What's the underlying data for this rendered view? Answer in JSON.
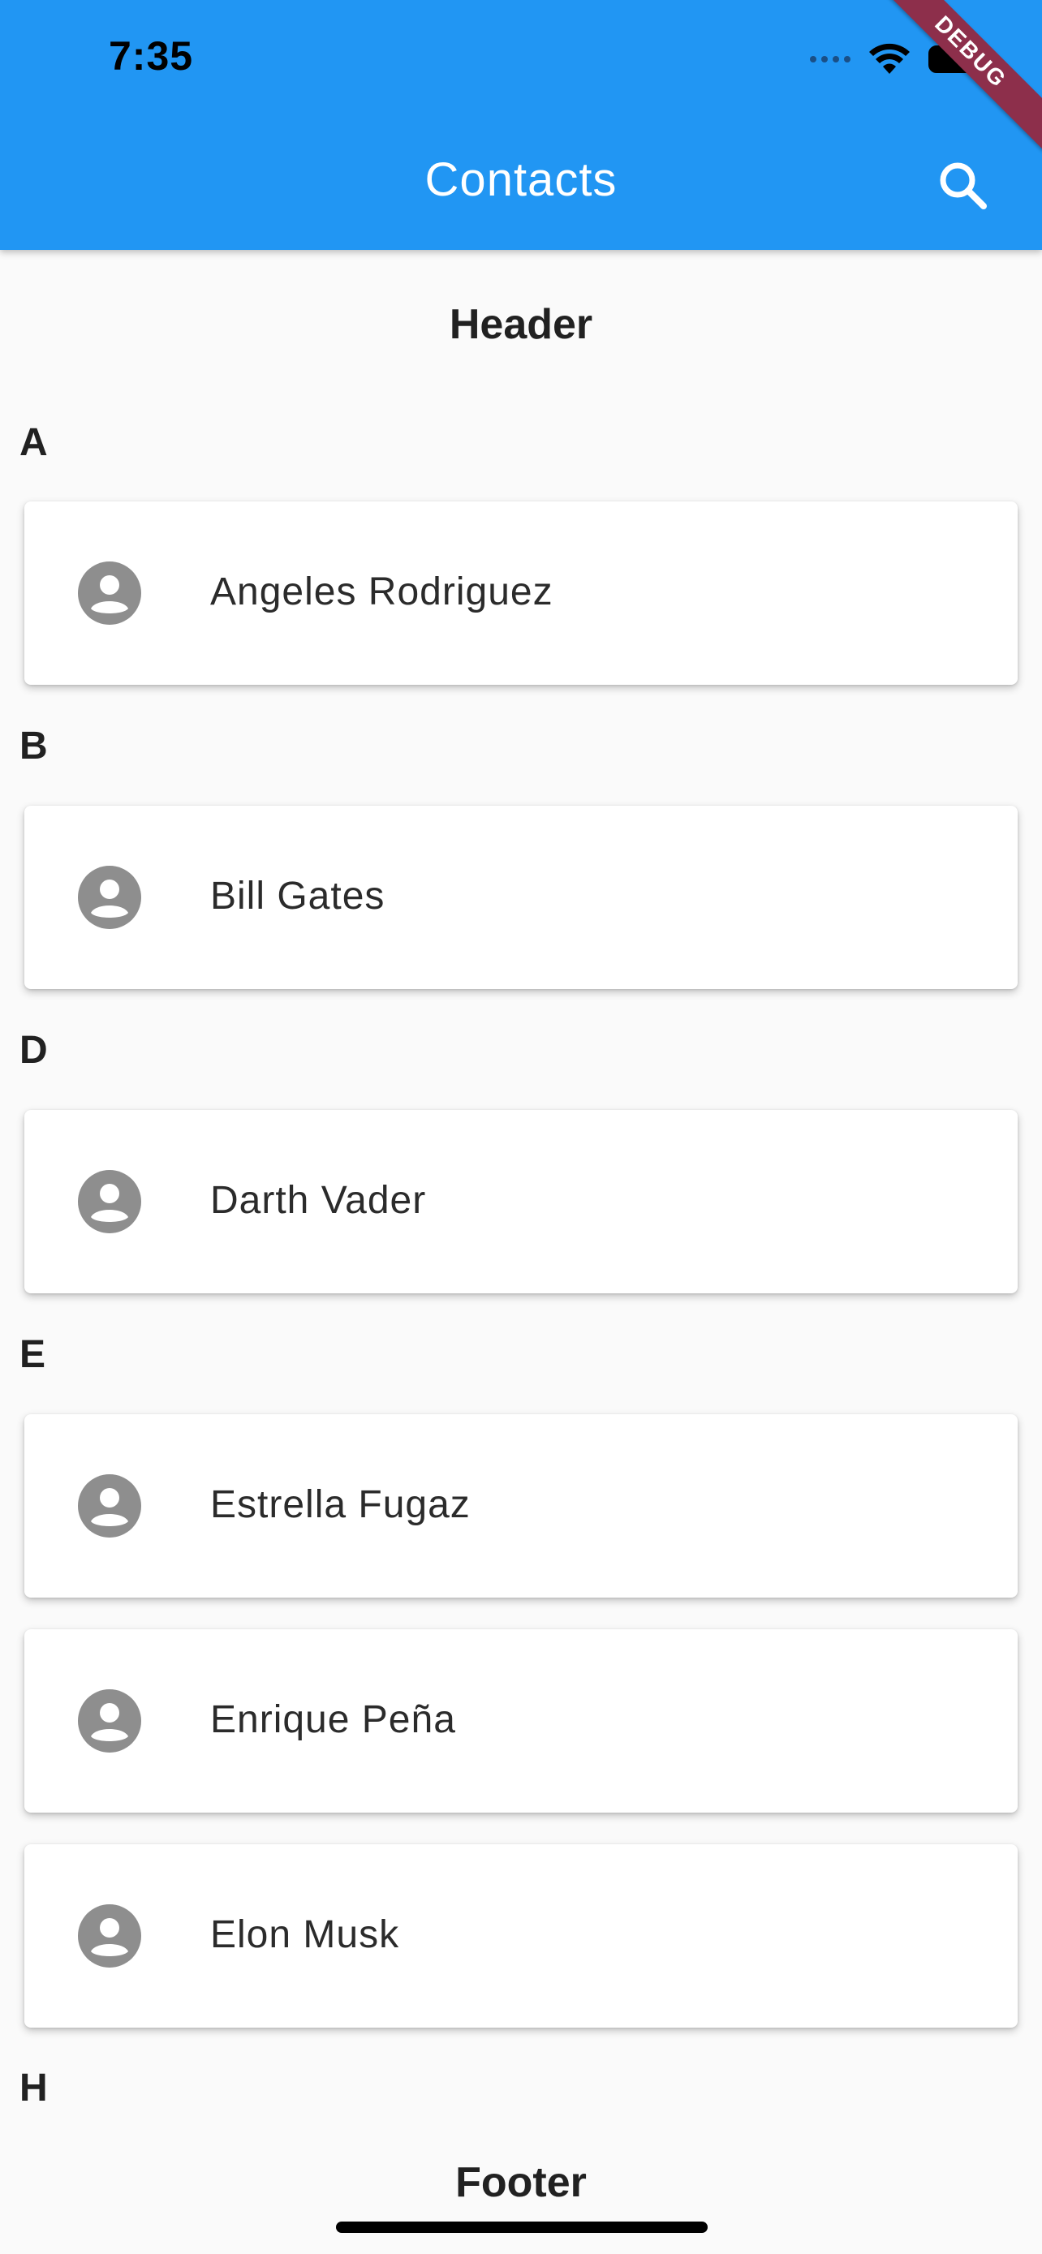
{
  "status_bar": {
    "time": "7:35"
  },
  "app_bar": {
    "title": "Contacts",
    "search_icon": "search-icon"
  },
  "debug_banner": "DEBUG",
  "list": {
    "header": "Header",
    "footer": "Footer",
    "sections": [
      {
        "letter": "A",
        "contacts": [
          "Angeles Rodriguez"
        ]
      },
      {
        "letter": "B",
        "contacts": [
          "Bill Gates"
        ]
      },
      {
        "letter": "D",
        "contacts": [
          "Darth Vader"
        ]
      },
      {
        "letter": "E",
        "contacts": [
          "Estrella Fugaz",
          "Enrique Peña",
          "Elon Musk"
        ]
      },
      {
        "letter": "H",
        "contacts": []
      }
    ]
  },
  "colors": {
    "app_bar": "#2196f3",
    "background": "#fafafa",
    "card": "#ffffff",
    "avatar": "#8e8e8e",
    "debug_ribbon": "#8d2f4b"
  }
}
